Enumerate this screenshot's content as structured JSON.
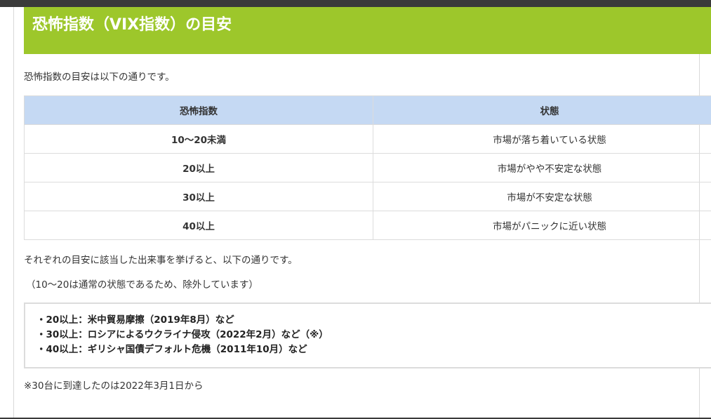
{
  "heading": "恐怖指数（VIX指数）の目安",
  "intro": "恐怖指数の目安は以下の通りです。",
  "table": {
    "headers": [
      "恐怖指数",
      "状態"
    ],
    "rows": [
      {
        "level": "10～20未満",
        "state": "市場が落ち着いている状態"
      },
      {
        "level": "20以上",
        "state": "市場がやや不安定な状態"
      },
      {
        "level": "30以上",
        "state": "市場が不安定な状態"
      },
      {
        "level": "40以上",
        "state": "市場がパニックに近い状態"
      }
    ]
  },
  "note1": "それぞれの目安に該当した出来事を挙げると、以下の通りです。",
  "note2": "（10～20は通常の状態であるため、除外しています）",
  "events": [
    "・20以上：米中貿易摩擦（2019年8月）など",
    "・30以上：ロシアによるウクライナ侵攻（2022年2月）など（※）",
    "・40以上：ギリシャ国債デフォルト危機（2011年10月）など"
  ],
  "footnote": "※30台に到達したのは2022年3月1日から",
  "colors": {
    "heading_bg": "#9dc72b",
    "table_header_bg": "#c5d9f3",
    "border": "#dcdcdc"
  }
}
